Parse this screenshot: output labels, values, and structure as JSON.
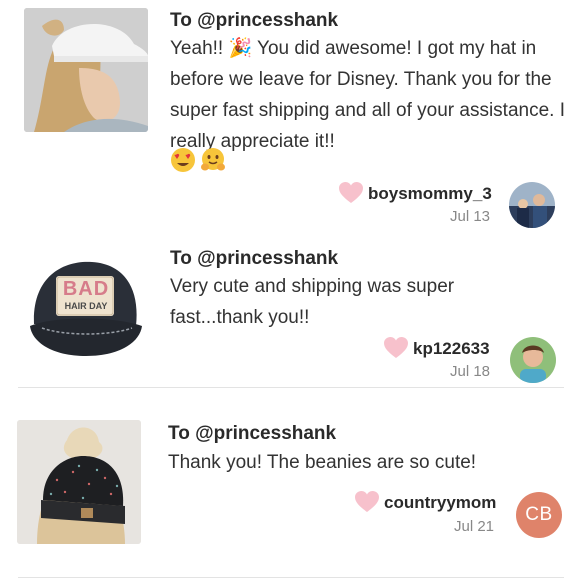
{
  "reviews": [
    {
      "to": "To @princesshank",
      "message": "Yeah!! 🎉 You did awesome! I got my hat in before we leave for Disney. Thank you for the super fast shipping and all of your assistance. I really appreciate it!!",
      "emojis": [
        "heart-eyes-emoji",
        "hugging-face-emoji"
      ],
      "username": "boysmommy_3",
      "date": "Jul 13",
      "product": "white-ponytail-cap-photo"
    },
    {
      "to": "To @princesshank",
      "message": "Very cute and shipping was super fast...thank you!!",
      "username": "kp122633",
      "date": "Jul 18",
      "product": "bad-hair-day-cap-photo",
      "hat_text_top": "BAD",
      "hat_text_bottom": "HAIR DAY"
    },
    {
      "to": "To @princesshank",
      "message": "Thank you! The beanies are so cute!",
      "username": "countryymom",
      "date": "Jul 21",
      "avatar_initials": "CB",
      "product": "messy-bun-beanie-photo"
    }
  ],
  "colors": {
    "heart": "#f7c1cc",
    "avatar_cb": "#df836a",
    "divider": "#e3e3e3"
  }
}
